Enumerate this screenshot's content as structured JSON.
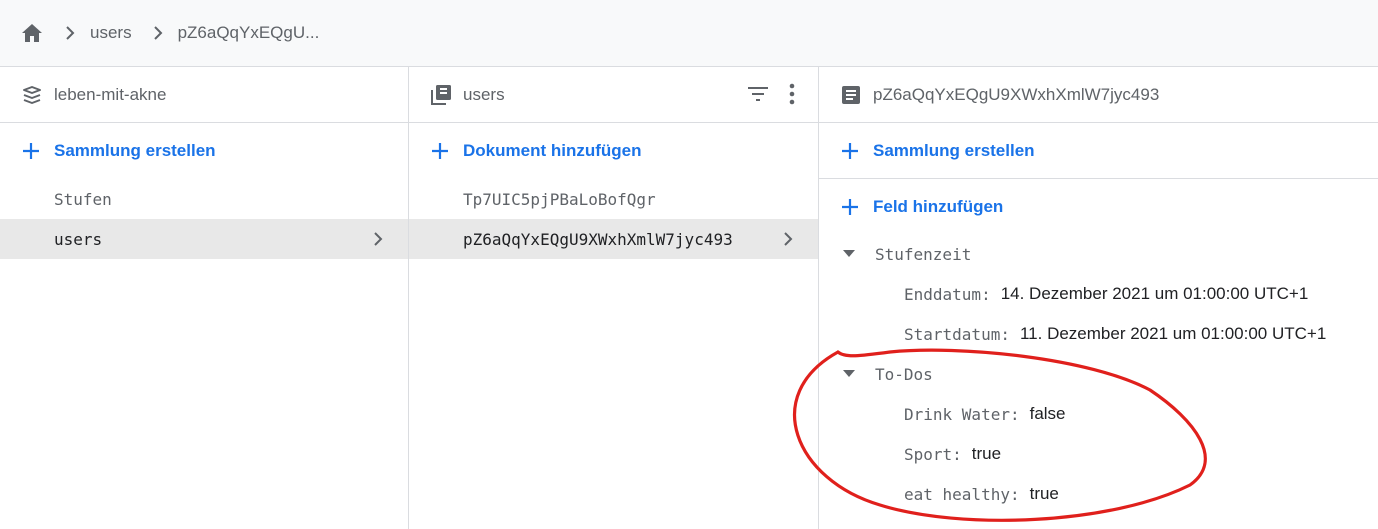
{
  "breadcrumb": {
    "home_icon": "home-icon",
    "items": [
      {
        "label": "users"
      },
      {
        "label": "pZ6aQqYxEQgU..."
      }
    ]
  },
  "columns": [
    {
      "header": {
        "icon": "database-stack-icon",
        "title": "leben-mit-akne"
      },
      "add_label": "Sammlung erstellen",
      "items": [
        {
          "label": "Stufen",
          "selected": false
        },
        {
          "label": "users",
          "selected": true
        }
      ]
    },
    {
      "header": {
        "icon": "collection-icon",
        "title": "users"
      },
      "add_label": "Dokument hinzufügen",
      "items": [
        {
          "label": "Tp7UIC5pjPBaLoBofQgr",
          "selected": false
        },
        {
          "label": "pZ6aQqYxEQgU9XWxhXmlW7jyc493",
          "selected": true
        }
      ]
    },
    {
      "header": {
        "icon": "document-icon",
        "title": "pZ6aQqYxEQgU9XWxhXmlW7jyc493"
      },
      "add_collection_label": "Sammlung erstellen",
      "add_field_label": "Feld hinzufügen",
      "groups": [
        {
          "name": "Stufenzeit",
          "fields": [
            {
              "key": "Enddatum:",
              "value": "14. Dezember 2021 um 01:00:00 UTC+1"
            },
            {
              "key": "Startdatum:",
              "value": "11. Dezember 2021 um 01:00:00 UTC+1"
            }
          ]
        },
        {
          "name": "To-Dos",
          "fields": [
            {
              "key": "Drink Water:",
              "value": "false"
            },
            {
              "key": "Sport:",
              "value": "true"
            },
            {
              "key": "eat healthy:",
              "value": "true"
            }
          ]
        }
      ]
    }
  ],
  "colors": {
    "accent": "#1a73e8",
    "annotation": "#e0201c",
    "selected_bg": "#e8e8e8"
  }
}
